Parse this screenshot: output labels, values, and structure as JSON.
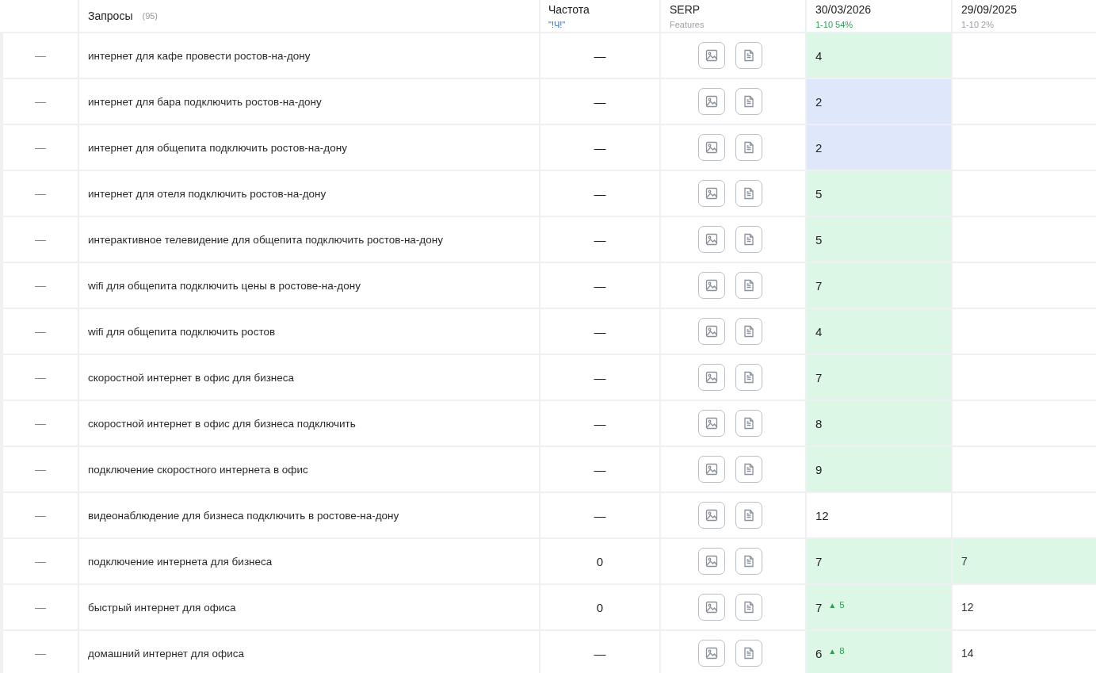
{
  "header": {
    "query_title": "Запросы",
    "query_count": "(95)",
    "freq_title": "Частота",
    "freq_sub": "\"!Ч!\"",
    "serp_title": "SERP",
    "serp_sub": "Features",
    "dates": [
      {
        "date": "30/03/2026",
        "stat": "1-10 54%",
        "color": "#2e9e55"
      },
      {
        "date": "29/09/2025",
        "stat": "1-10 2%",
        "color": "#9a9ea5"
      }
    ]
  },
  "rows": [
    {
      "mark": "—",
      "query": "интернет для кафе провести ростов-на-дону",
      "freq": "—",
      "pos_now": {
        "value": "4",
        "color": "#dcf7e6"
      }
    },
    {
      "mark": "—",
      "query": "интернет для бара подключить ростов-на-дону",
      "freq": "—",
      "pos_now": {
        "value": "2",
        "color": "#dfe8fb"
      }
    },
    {
      "mark": "—",
      "query": "интернет для общепита подключить ростов-на-дону",
      "freq": "—",
      "pos_now": {
        "value": "2",
        "color": "#dfe8fb"
      }
    },
    {
      "mark": "—",
      "query": "интернет для отеля подключить ростов-на-дону",
      "freq": "—",
      "pos_now": {
        "value": "5",
        "color": "#dcf7e6"
      }
    },
    {
      "mark": "—",
      "query": "интерактивное телевидение для общепита подключить ростов-на-дону",
      "freq": "—",
      "pos_now": {
        "value": "5",
        "color": "#dcf7e6"
      }
    },
    {
      "mark": "—",
      "query": "wifi для общепита подключить цены в ростове-на-дону",
      "freq": "—",
      "pos_now": {
        "value": "7",
        "color": "#dcf7e6"
      }
    },
    {
      "mark": "—",
      "query": "wifi для общепита подключить ростов",
      "freq": "—",
      "pos_now": {
        "value": "4",
        "color": "#dcf7e6"
      }
    },
    {
      "mark": "—",
      "query": "скоростной интернет в офис для бизнеса",
      "freq": "—",
      "pos_now": {
        "value": "7",
        "color": "#dcf7e6"
      }
    },
    {
      "mark": "—",
      "query": "скоростной интернет в офис для бизнеса подключить",
      "freq": "—",
      "pos_now": {
        "value": "8",
        "color": "#dcf7e6"
      }
    },
    {
      "mark": "—",
      "query": "подключение скоростного интернета в офис",
      "freq": "—",
      "pos_now": {
        "value": "9",
        "color": "#dcf7e6"
      }
    },
    {
      "mark": "—",
      "query": "видеонаблюдение для бизнеса подключить в ростове-на-дону",
      "freq": "—",
      "pos_now": {
        "value": "12"
      }
    },
    {
      "mark": "—",
      "query": "подключение интернета для бизнеса",
      "freq": "0",
      "pos_now": {
        "value": "7",
        "color": "#dcf7e6"
      },
      "pos_prev": {
        "value": "7",
        "color": "#dcf7e6"
      }
    },
    {
      "mark": "—",
      "query": "быстрый интернет для офиса",
      "freq": "0",
      "pos_now": {
        "value": "7",
        "color": "#dcf7e6",
        "arrow": "▲",
        "change": "5"
      },
      "pos_prev": {
        "value": "12"
      }
    },
    {
      "mark": "—",
      "query": "домашний интернет для офиса",
      "freq": "—",
      "pos_now": {
        "value": "6",
        "color": "#dcf7e6",
        "arrow": "▲",
        "change": "8"
      },
      "pos_prev": {
        "value": "14"
      }
    }
  ]
}
